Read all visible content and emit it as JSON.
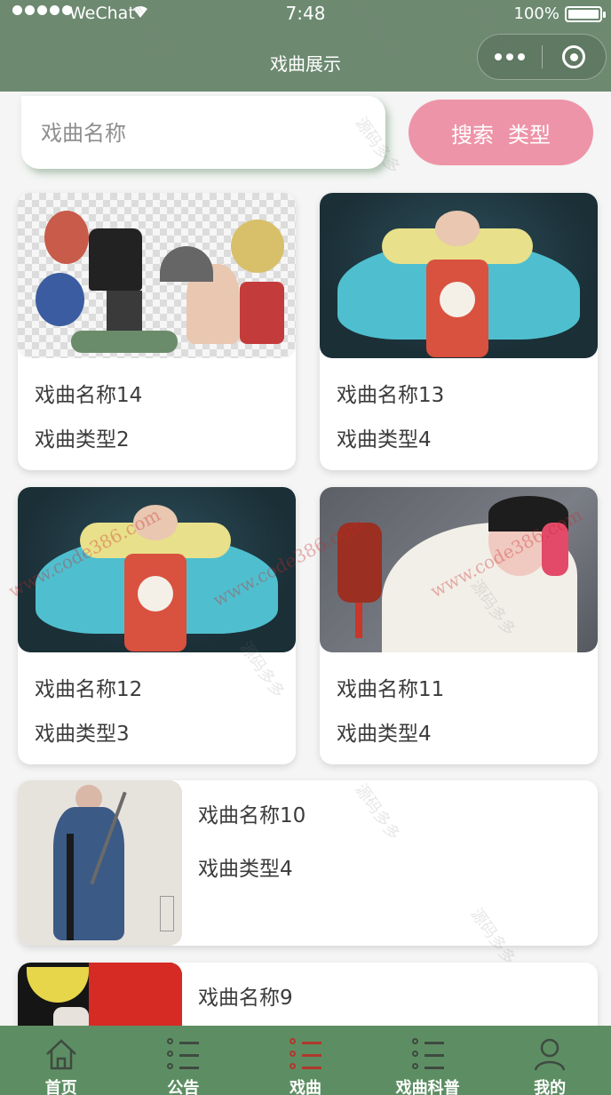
{
  "status": {
    "carrier": "WeChat",
    "time": "7:48",
    "battery": "100%"
  },
  "nav": {
    "title": "戏曲展示"
  },
  "search": {
    "placeholder": "戏曲名称",
    "button_search": "搜索",
    "button_type": "类型"
  },
  "items": [
    {
      "name": "戏曲名称14",
      "type": "戏曲类型2"
    },
    {
      "name": "戏曲名称13",
      "type": "戏曲类型4"
    },
    {
      "name": "戏曲名称12",
      "type": "戏曲类型3"
    },
    {
      "name": "戏曲名称11",
      "type": "戏曲类型4"
    },
    {
      "name": "戏曲名称10",
      "type": "戏曲类型4"
    },
    {
      "name": "戏曲名称9",
      "type": ""
    }
  ],
  "tabbar": [
    {
      "label": "首页",
      "icon": "home-icon"
    },
    {
      "label": "公告",
      "icon": "list-icon"
    },
    {
      "label": "戏曲",
      "icon": "list-icon",
      "active": true
    },
    {
      "label": "戏曲科普",
      "icon": "list-icon"
    },
    {
      "label": "我的",
      "icon": "user-icon"
    }
  ],
  "colors": {
    "nav_bg": "#6d8a71",
    "tabbar_bg": "#5d8e63",
    "search_button": "#ee94a8",
    "active_tab_icon": "#b0382c"
  },
  "watermark": {
    "cn": "源码多多",
    "url": "www.code386.com"
  }
}
